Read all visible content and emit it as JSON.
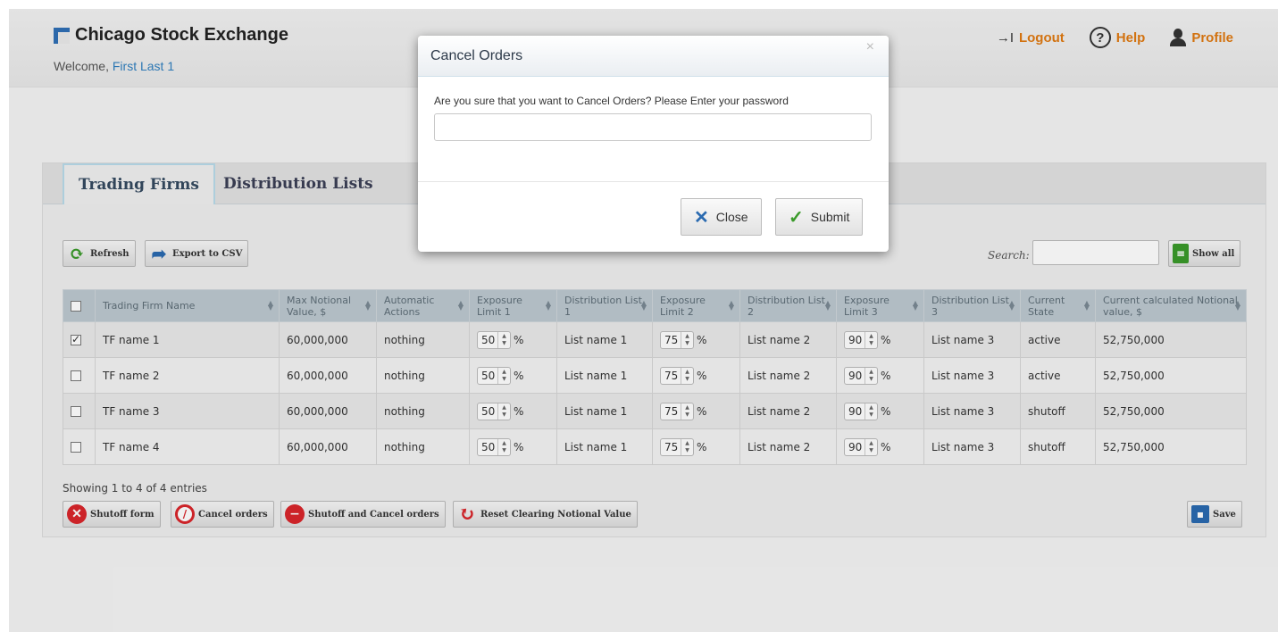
{
  "header": {
    "brand": "Chicago Stock Exchange",
    "welcome_prefix": "Welcome, ",
    "user_name": "First Last 1",
    "logout_label": "Logout",
    "help_label": "Help",
    "profile_label": "Profile"
  },
  "tabs": [
    {
      "label": "Trading Firms",
      "active": true
    },
    {
      "label": "Distribution Lists",
      "active": false
    }
  ],
  "toolbar": {
    "refresh_label": "Refresh",
    "export_label": "Export to CSV",
    "search_label": "Search:",
    "search_value": "",
    "show_all_label": "Show all"
  },
  "table": {
    "columns": [
      "",
      "Trading Firm Name",
      "Max Notional Value, $",
      "Automatic Actions",
      "Exposure Limit 1",
      "Distribution List 1",
      "Exposure Limit 2",
      "Distribution List 2",
      "Exposure Limit 3",
      "Distribution List 3",
      "Current State",
      "Current calculated Notional value, $"
    ],
    "rows": [
      {
        "checked": true,
        "name": "TF name 1",
        "max_notional": "60,000,000",
        "actions": "nothing",
        "exp1": "50",
        "dist1": "List name 1",
        "exp2": "75",
        "dist2": "List name 2",
        "exp3": "90",
        "dist3": "List name 3",
        "state": "active",
        "current_value": "52,750,000"
      },
      {
        "checked": false,
        "name": "TF name 2",
        "max_notional": "60,000,000",
        "actions": "nothing",
        "exp1": "50",
        "dist1": "List name 1",
        "exp2": "75",
        "dist2": "List name 2",
        "exp3": "90",
        "dist3": "List name 3",
        "state": "active",
        "current_value": "52,750,000"
      },
      {
        "checked": false,
        "name": "TF name 3",
        "max_notional": "60,000,000",
        "actions": "nothing",
        "exp1": "50",
        "dist1": "List name 1",
        "exp2": "75",
        "dist2": "List name 2",
        "exp3": "90",
        "dist3": "List name 3",
        "state": "shutoff",
        "current_value": "52,750,000"
      },
      {
        "checked": false,
        "name": "TF name 4",
        "max_notional": "60,000,000",
        "actions": "nothing",
        "exp1": "50",
        "dist1": "List name 1",
        "exp2": "75",
        "dist2": "List name 2",
        "exp3": "90",
        "dist3": "List name 3",
        "state": "shutoff",
        "current_value": "52,750,000"
      }
    ],
    "percent_suffix": "%",
    "info": "Showing 1 to 4 of 4 entries"
  },
  "actions": {
    "shutoff_form": "Shutoff form",
    "cancel_orders": "Cancel orders",
    "shutoff_cancel": "Shutoff and Cancel orders",
    "reset_clearing": "Reset Clearing Notional Value",
    "save": "Save"
  },
  "modal": {
    "title": "Cancel Orders",
    "close_x": "×",
    "message": "Are you sure that you want to Cancel Orders? Please Enter your password",
    "password_value": "",
    "close_label": "Close",
    "submit_label": "Submit"
  },
  "colors": {
    "brand": "#2f6fb5",
    "accent_orange": "#e07a12",
    "active_state": "#3a8a1e",
    "shutoff_state": "#c0392b"
  },
  "icons": [
    "logout-icon",
    "help-icon",
    "profile-icon",
    "refresh-icon",
    "export-icon",
    "search-icon",
    "show-all-icon",
    "shutoff-icon",
    "cancel-icon",
    "shutoff-cancel-icon",
    "reset-icon",
    "save-icon",
    "close-icon",
    "check-icon"
  ]
}
